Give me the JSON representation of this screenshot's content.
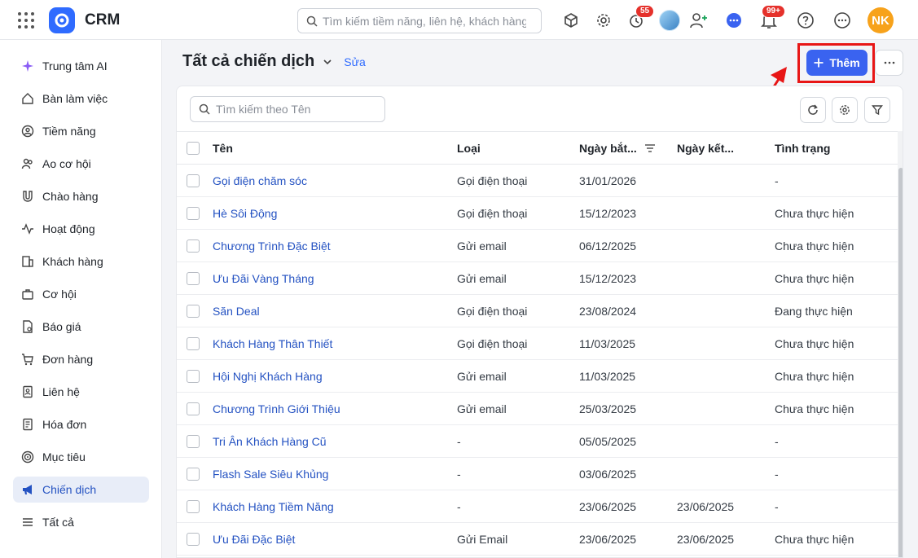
{
  "app": {
    "title": "CRM"
  },
  "topbar": {
    "search_placeholder": "Tìm kiếm tiềm năng, liên hệ, khách hàng",
    "timer_badge": "55",
    "notification_badge": "99+",
    "user_initials": "NK"
  },
  "sidebar": {
    "items": [
      {
        "label": "Trung tâm AI",
        "icon": "sparkle-icon"
      },
      {
        "label": "Bàn làm việc",
        "icon": "home-icon"
      },
      {
        "label": "Tiềm năng",
        "icon": "user-circle-icon"
      },
      {
        "label": "Ao cơ hội",
        "icon": "users-icon"
      },
      {
        "label": "Chào hàng",
        "icon": "magnet-icon"
      },
      {
        "label": "Hoạt động",
        "icon": "activity-icon"
      },
      {
        "label": "Khách hàng",
        "icon": "building-icon"
      },
      {
        "label": "Cơ hội",
        "icon": "briefcase-icon"
      },
      {
        "label": "Báo giá",
        "icon": "quote-doc-icon"
      },
      {
        "label": "Đơn hàng",
        "icon": "cart-icon"
      },
      {
        "label": "Liên hệ",
        "icon": "contact-icon"
      },
      {
        "label": "Hóa đơn",
        "icon": "invoice-icon"
      },
      {
        "label": "Mục tiêu",
        "icon": "target-icon"
      },
      {
        "label": "Chiến dịch",
        "icon": "megaphone-icon",
        "active": true
      },
      {
        "label": "Tất cả",
        "icon": "menu-icon"
      }
    ]
  },
  "main": {
    "title": "Tất cả chiến dịch",
    "edit_label": "Sửa",
    "add_label": "Thêm",
    "table_search_placeholder": "Tìm kiếm theo Tên",
    "columns": [
      "Tên",
      "Loại",
      "Ngày bắt...",
      "Ngày kết...",
      "Tình trạng"
    ],
    "rows": [
      [
        "Gọi điện chăm sóc",
        "Gọi điện thoại",
        "31/01/2026",
        "",
        "-"
      ],
      [
        "Hè Sôi Động",
        "Gọi điện thoại",
        "15/12/2023",
        "",
        "Chưa thực hiện"
      ],
      [
        "Chương Trình Đặc Biệt",
        "Gửi email",
        "06/12/2025",
        "",
        "Chưa thực hiện"
      ],
      [
        "Ưu Đãi Vàng Tháng",
        "Gửi email",
        "15/12/2023",
        "",
        "Chưa thực hiện"
      ],
      [
        "Săn Deal",
        "Gọi điện thoại",
        "23/08/2024",
        "",
        "Đang thực hiện"
      ],
      [
        "Khách Hàng Thân Thiết",
        "Gọi điện thoại",
        "11/03/2025",
        "",
        "Chưa thực hiện"
      ],
      [
        "Hội Nghị Khách Hàng",
        "Gửi email",
        "11/03/2025",
        "",
        "Chưa thực hiện"
      ],
      [
        "Chương Trình Giới Thiệu",
        "Gửi email",
        "25/03/2025",
        "",
        "Chưa thực hiện"
      ],
      [
        "Tri Ân Khách Hàng Cũ",
        "-",
        "05/05/2025",
        "",
        "-"
      ],
      [
        "Flash Sale Siêu Khủng",
        "-",
        "03/06/2025",
        "",
        "-"
      ],
      [
        "Khách Hàng Tiềm Năng",
        "-",
        "23/06/2025",
        "23/06/2025",
        "-"
      ],
      [
        "Ưu Đãi Đặc Biệt",
        "Gửi Email",
        "23/06/2025",
        "23/06/2025",
        "Chưa thực hiện"
      ]
    ]
  },
  "colors": {
    "accent": "#3a63f0",
    "link": "#2452c2",
    "highlight": "#e81616",
    "avatar": "#f7a21b"
  }
}
